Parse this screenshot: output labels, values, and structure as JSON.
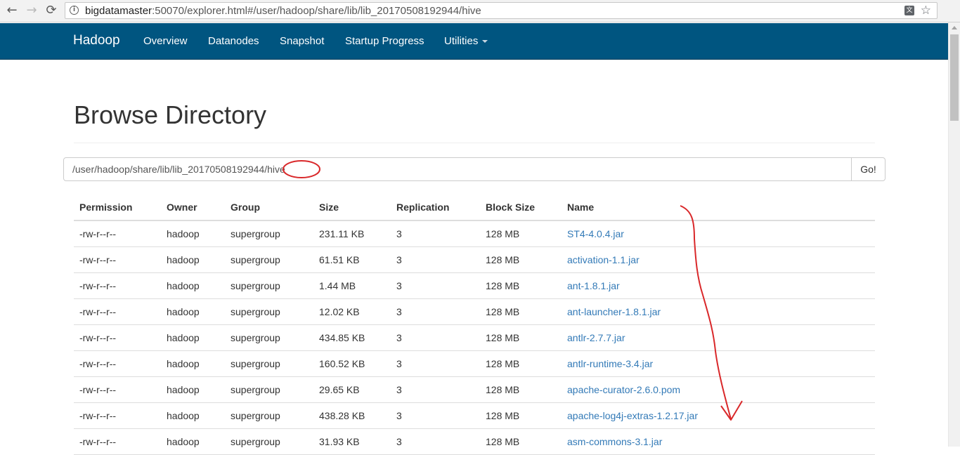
{
  "browser": {
    "url_host": "bigdatamaster",
    "url_rest": ":50070/explorer.html#/user/hadoop/share/lib/lib_20170508192944/hive",
    "back_icon": "←",
    "forward_icon": "→",
    "reload_icon": "⟳",
    "info_icon": "i",
    "translate_icon": "文",
    "star_icon": "☆"
  },
  "navbar": {
    "brand": "Hadoop",
    "links": [
      "Overview",
      "Datanodes",
      "Snapshot",
      "Startup Progress",
      "Utilities"
    ],
    "background": "#005580"
  },
  "page": {
    "title": "Browse Directory",
    "path_value": "/user/hadoop/share/lib/lib_20170508192944/hive",
    "go_label": "Go!"
  },
  "table": {
    "headers": [
      "Permission",
      "Owner",
      "Group",
      "Size",
      "Replication",
      "Block Size",
      "Name"
    ],
    "rows": [
      [
        "-rw-r--r--",
        "hadoop",
        "supergroup",
        "231.11 KB",
        "3",
        "128 MB",
        "ST4-4.0.4.jar"
      ],
      [
        "-rw-r--r--",
        "hadoop",
        "supergroup",
        "61.51 KB",
        "3",
        "128 MB",
        "activation-1.1.jar"
      ],
      [
        "-rw-r--r--",
        "hadoop",
        "supergroup",
        "1.44 MB",
        "3",
        "128 MB",
        "ant-1.8.1.jar"
      ],
      [
        "-rw-r--r--",
        "hadoop",
        "supergroup",
        "12.02 KB",
        "3",
        "128 MB",
        "ant-launcher-1.8.1.jar"
      ],
      [
        "-rw-r--r--",
        "hadoop",
        "supergroup",
        "434.85 KB",
        "3",
        "128 MB",
        "antlr-2.7.7.jar"
      ],
      [
        "-rw-r--r--",
        "hadoop",
        "supergroup",
        "160.52 KB",
        "3",
        "128 MB",
        "antlr-runtime-3.4.jar"
      ],
      [
        "-rw-r--r--",
        "hadoop",
        "supergroup",
        "29.65 KB",
        "3",
        "128 MB",
        "apache-curator-2.6.0.pom"
      ],
      [
        "-rw-r--r--",
        "hadoop",
        "supergroup",
        "438.28 KB",
        "3",
        "128 MB",
        "apache-log4j-extras-1.2.17.jar"
      ],
      [
        "-rw-r--r--",
        "hadoop",
        "supergroup",
        "31.93 KB",
        "3",
        "128 MB",
        "asm-commons-3.1.jar"
      ]
    ],
    "link_color": "#337ab7"
  },
  "annotations": {
    "color": "#d9282a"
  }
}
